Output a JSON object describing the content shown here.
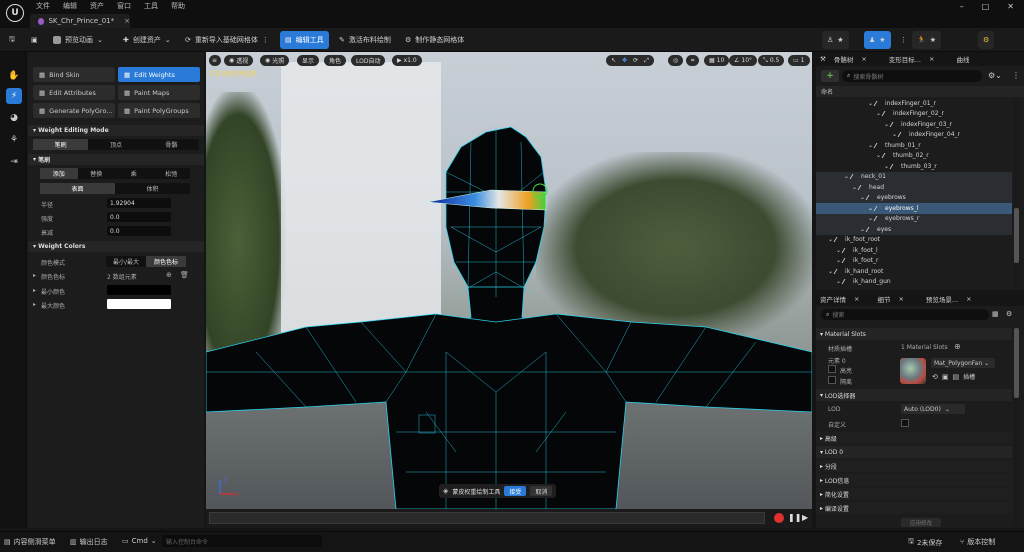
{
  "menu": [
    "文件",
    "编辑",
    "资产",
    "窗口",
    "工具",
    "帮助"
  ],
  "doc_tab": "SK_Chr_Prince_01*",
  "toolbar": {
    "preview_anim": "预览动画",
    "create_asset": "创建资产",
    "reimport": "重新导入基础网格体",
    "edit_tools": "编辑工具",
    "activate_cloth": "激活布料绘制",
    "make_static": "制作静态网格体"
  },
  "left_panel": {
    "modes": [
      "Bind Skin",
      "Edit Weights",
      "Edit Attributes",
      "Paint Maps",
      "Generate PolyGro...",
      "Paint PolyGroups"
    ],
    "weight_editing_mode": "Weight Editing Mode",
    "mode_seg": [
      "笔刷",
      "顶点",
      "骨骼"
    ],
    "brush": "笔刷",
    "brush_ops": [
      "添加",
      "替换",
      "乘",
      "松弛"
    ],
    "brush_area": [
      "表面",
      "体积"
    ],
    "radius_label": "半径",
    "radius_value": "1.92904",
    "strength_label": "强度",
    "strength_value": "0.0",
    "falloff_label": "衰减",
    "falloff_value": "0.0",
    "weight_colors": "Weight Colors",
    "color_mode_label": "颜色模式",
    "color_mode_opts": [
      "最小/最大",
      "颜色色标"
    ],
    "color_ramp_label": "颜色色标",
    "color_ramp_value": "2 数组元素",
    "min_color_label": "最小颜色",
    "max_color_label": "最大颜色",
    "min_color": "#000000",
    "max_color": "#ffffff"
  },
  "viewport": {
    "buttons": [
      "透视",
      "光照",
      "显示",
      "角色",
      "LOD自动",
      "x1.0"
    ],
    "label": "正在预览参考姿势",
    "grid": "10",
    "angle": "10°",
    "scale": "0.5",
    "cam": "1",
    "overlay_label": "蒙皮权重绘制工具",
    "accept": "接受",
    "cancel": "取消"
  },
  "outliner": {
    "tabs": [
      "骨骼树",
      "变形目标...",
      "曲线"
    ],
    "search_placeholder": "搜索骨骼树",
    "col_name": "命名",
    "bones": [
      {
        "name": "indexFinger_01_r",
        "indent": 6
      },
      {
        "name": "indexFinger_02_r",
        "indent": 7
      },
      {
        "name": "indexFinger_03_r",
        "indent": 8
      },
      {
        "name": "indexFinger_04_r",
        "indent": 9
      },
      {
        "name": "thumb_01_r",
        "indent": 6
      },
      {
        "name": "thumb_02_r",
        "indent": 7
      },
      {
        "name": "thumb_03_r",
        "indent": 8
      },
      {
        "name": "neck_01",
        "indent": 3
      },
      {
        "name": "head",
        "indent": 4
      },
      {
        "name": "eyebrows",
        "indent": 5
      },
      {
        "name": "eyebrows_l",
        "indent": 6
      },
      {
        "name": "eyebrows_r",
        "indent": 6
      },
      {
        "name": "eyes",
        "indent": 5
      },
      {
        "name": "ik_foot_root",
        "indent": 1
      },
      {
        "name": "ik_foot_l",
        "indent": 2
      },
      {
        "name": "ik_foot_r",
        "indent": 2
      },
      {
        "name": "ik_hand_root",
        "indent": 1
      },
      {
        "name": "ik_hand_gun",
        "indent": 2
      }
    ],
    "selected": "eyebrows_l"
  },
  "details": {
    "tabs": [
      "资产详情",
      "细节",
      "预览场景..."
    ],
    "search_placeholder": "搜索",
    "material_slots": "Material Slots",
    "material_slots_label": "材质插槽",
    "material_slots_value": "1 Material Slots",
    "element_label": "元素 0",
    "highlight": "高亮",
    "isolate": "隔离",
    "material_name": "Mat_PolygonFan",
    "more": "插槽",
    "lod_picker": "LOD选择器",
    "lod_label": "LOD",
    "lod_value": "Auto (LOD0)",
    "custom_label": "自定义",
    "advanced": "高级",
    "lod0": "LOD 0",
    "sections": "分段",
    "lod_info": "LOD信息",
    "reduction": "简化设置",
    "build": "编译设置",
    "apply": "应用修改"
  },
  "status": {
    "content_drawer": "内容侧滑菜单",
    "output_log": "输出日志",
    "cmd": "Cmd",
    "cmd_placeholder": "输入控制台命令",
    "unsaved": "2未保存",
    "version_control": "版本控制"
  }
}
